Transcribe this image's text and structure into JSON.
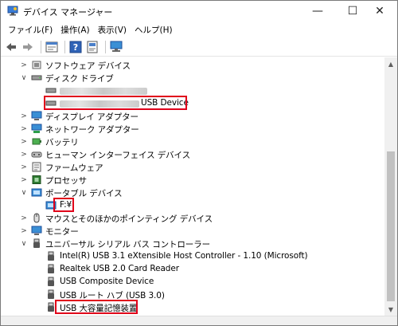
{
  "window": {
    "title": "デバイス マネージャー",
    "minimize": "—",
    "maximize": "☐",
    "close": "✕"
  },
  "menu": [
    "ファイル(F)",
    "操作(A)",
    "表示(V)",
    "ヘルプ(H)"
  ],
  "toolbar": [
    "back-icon",
    "forward-icon",
    "properties-icon",
    "help-icon",
    "driver-icon",
    "monitor-icon"
  ],
  "tree": {
    "software": "ソフトウェア デバイス",
    "disk_drives": "ディスク ドライブ",
    "disk_usb_device": "USB Device",
    "display_adapters": "ディスプレイ アダプター",
    "network_adapters": "ネットワーク アダプター",
    "battery": "バッテリ",
    "hid": "ヒューマン インターフェイス デバイス",
    "firmware": "ファームウェア",
    "processor": "プロセッサ",
    "portable": "ポータブル デバイス",
    "portable_f": "F:¥",
    "mouse": "マウスとそのほかのポインティング デバイス",
    "monitor": "モニター",
    "usb_controllers": "ユニバーサル シリアル バス コントローラー",
    "usb_items": [
      "Intel(R) USB 3.1 eXtensible Host Controller - 1.10 (Microsoft)",
      "Realtek USB 2.0 Card Reader",
      "USB Composite Device",
      "USB ルート ハブ (USB 3.0)",
      "USB 大容量記憶装置"
    ]
  },
  "colors": {
    "highlight": "#e0001a",
    "scrollbar": "#c1c1c1"
  }
}
